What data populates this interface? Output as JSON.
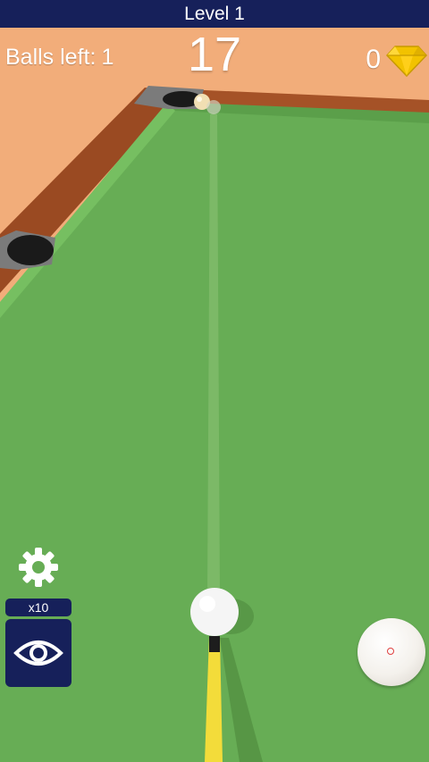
{
  "hud": {
    "level_label": "Level 1",
    "balls_left_label": "Balls left:",
    "balls_left_value": "1",
    "shots_value": "17",
    "gems_value": "0"
  },
  "controls": {
    "vision_multiplier": "x10"
  },
  "icons": {
    "gem": "diamond-gem-icon",
    "settings": "gear-icon",
    "vision": "eye-icon"
  },
  "colors": {
    "felt": "#67ad55",
    "wood": "#9a4a22",
    "floor": "#f2ad7a",
    "hud_bar": "#16205a",
    "cue": "#f3dc3a",
    "gem": "#f2c200"
  }
}
